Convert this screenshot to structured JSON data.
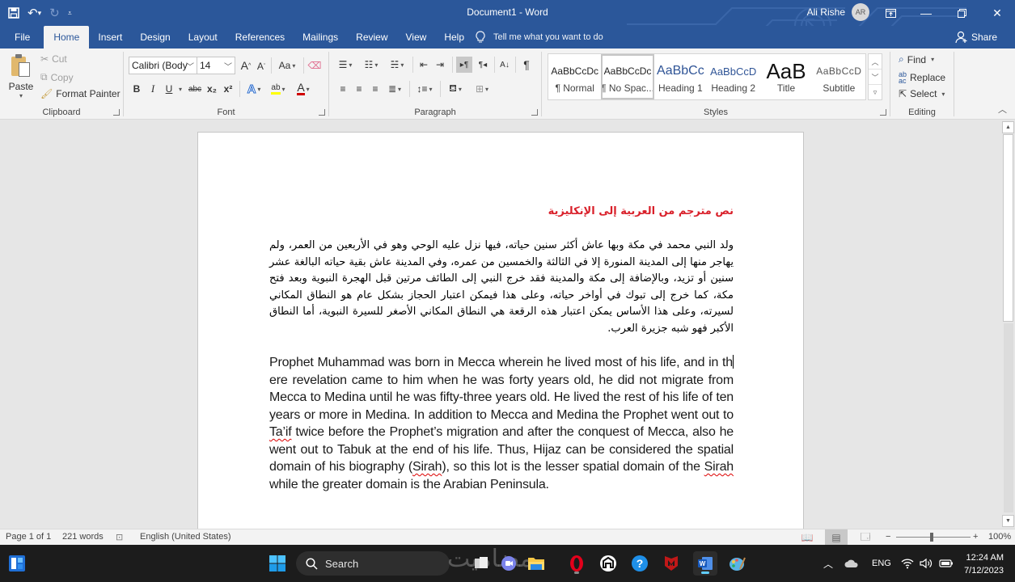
{
  "window": {
    "title": "Document1  -  Word",
    "user_name": "Ali Rishe",
    "user_initials": "AR"
  },
  "quick_access": {
    "save_icon": "save-icon",
    "undo_icon": "undo-icon",
    "redo_icon": "redo-icon",
    "customize_icon": "customize-qat-icon"
  },
  "tabs": [
    {
      "label": "File"
    },
    {
      "label": "Home",
      "active": true
    },
    {
      "label": "Insert"
    },
    {
      "label": "Design"
    },
    {
      "label": "Layout"
    },
    {
      "label": "References"
    },
    {
      "label": "Mailings"
    },
    {
      "label": "Review"
    },
    {
      "label": "View"
    },
    {
      "label": "Help"
    }
  ],
  "tell_me": {
    "placeholder": "Tell me what you want to do"
  },
  "share_label": "Share",
  "ribbon": {
    "clipboard": {
      "label": "Clipboard",
      "paste": "Paste",
      "cut": "Cut",
      "copy": "Copy",
      "format_painter": "Format Painter"
    },
    "font": {
      "label": "Font",
      "font_name": "Calibri (Body",
      "font_size": "14",
      "bold": "B",
      "italic": "I",
      "underline": "U",
      "strikethrough": "abc",
      "subscript": "x₂",
      "superscript": "x²",
      "grow": "A",
      "shrink": "A",
      "change_case": "Aa",
      "text_effects": "A",
      "highlight": "ab",
      "font_color": "A",
      "highlight_color": "#ffff00",
      "font_color_value": "#d00000"
    },
    "paragraph": {
      "label": "Paragraph"
    },
    "styles": {
      "label": "Styles",
      "items": [
        {
          "preview": "AaBbCcDc",
          "name": "¶ Normal"
        },
        {
          "preview": "AaBbCcDc",
          "name": "¶ No Spac...",
          "selected": true
        },
        {
          "preview": "AaBbCc",
          "name": "Heading 1"
        },
        {
          "preview": "AaBbCcD",
          "name": "Heading 2"
        },
        {
          "preview": "AaB",
          "name": "Title"
        },
        {
          "preview": "AaBbCcD",
          "name": "Subtitle"
        }
      ]
    },
    "editing": {
      "label": "Editing",
      "find": "Find",
      "replace": "Replace",
      "select": "Select"
    }
  },
  "document": {
    "arabic_title": "نص مترجم من العربية إلى الإنكليزية",
    "arabic_body": "ولد النبي محمد في مكة وبها عاش أكثر سنين حياته، فيها نزل عليه الوحي وهو في الأربعين من العمر، ولم يهاجر منها إلى المدينة المنورة إلا في الثالثة والخمسين من عمره، وفي المدينة عاش بقية حياته البالغة عشر سنين أو تزيد، وبالإضافة إلى مكة والمدينة فقد خرج النبي إلى الطائف مرتين قبل الهجرة النبوية وبعد فتح مكة، كما خرج إلى تبوك في أواخر حياته، وعلى هذا فيمكن اعتبار الحجاز بشكل عام هو النطاق المكاني لسيرته، وعلى هذا الأساس يمكن اعتبار هذه الرقعة هي النطاق المكاني الأصغر للسيرة النبوية، أما النطاق الأكبر فهو شبه جزيرة العرب.",
    "english_parts": {
      "p1a": "Prophet Muhammad was born in Mecca wherein he lived most of his life, and in th",
      "p1b": "ere revelation came to him when he was forty years old, he did not migrate from Mecca to Medina until he was fifty-three years old. He lived the rest of his life of ten years or more in Medina. In addition to Mecca and Medina the Prophet went out to ",
      "taif": "Ta’if",
      "p2": " twice before the Prophet’s migration and after the conquest of Mecca, also he went out to Tabuk at the end of his life. Thus, Hijaz can be considered the spatial domain of his biography (",
      "sirah1": "Sirah",
      "p3": "), so this lot is the lesser spatial domain of the ",
      "sirah2": "Sirah",
      "p4": " while the greater domain is the Arabian Peninsula."
    }
  },
  "status_bar": {
    "page": "Page 1 of 1",
    "words": "221 words",
    "language": "English (United States)",
    "zoom": "100%",
    "zoom_minus": "−",
    "zoom_plus": "+"
  },
  "taskbar": {
    "search_placeholder": "Search",
    "language": "ENG",
    "time": "12:24 AM",
    "date": "7/12/2023",
    "watermark": "مضاميت"
  }
}
